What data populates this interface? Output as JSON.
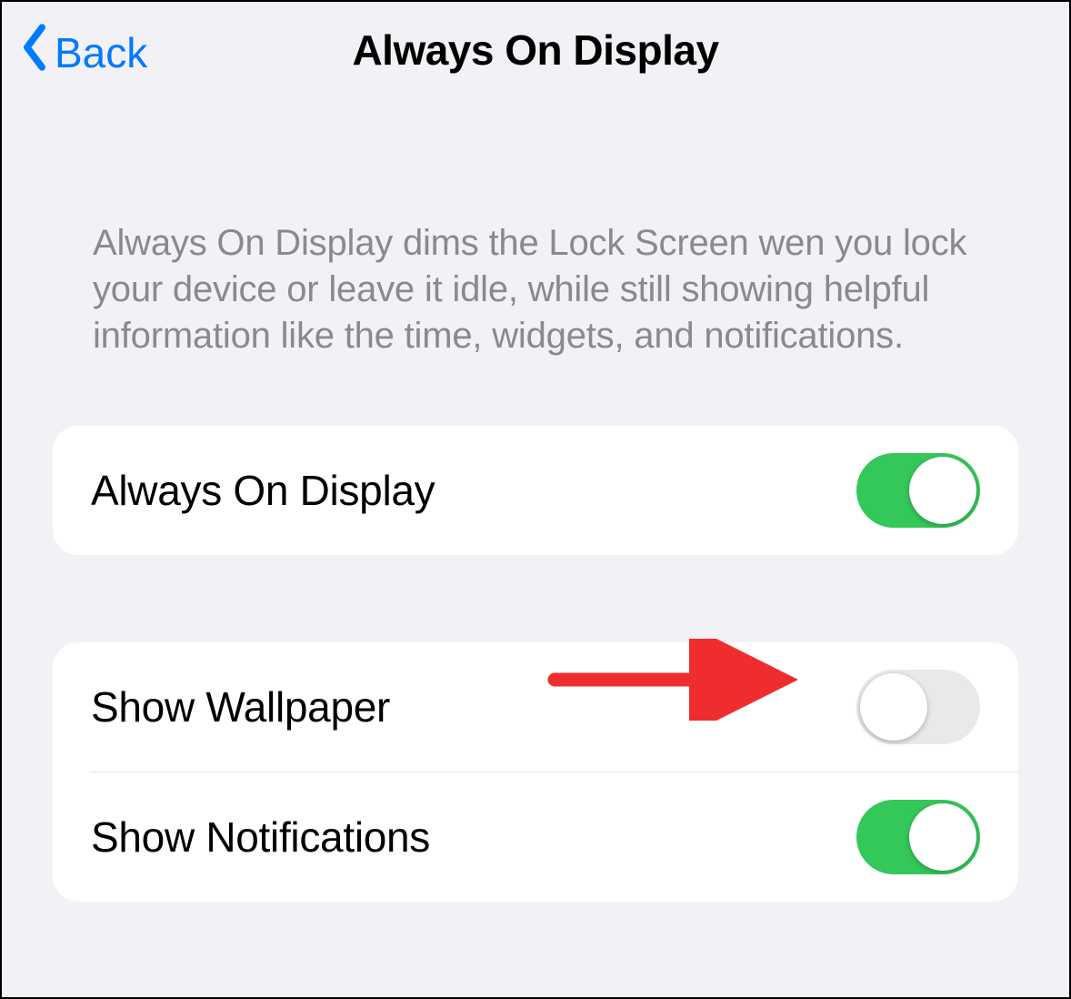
{
  "header": {
    "back_label": "Back",
    "title": "Always On Display"
  },
  "description": "Always On Display dims the Lock Screen wen you lock your device or leave it idle, while still showing helpful information like the time, widgets, and notifications.",
  "groups": {
    "primary": {
      "always_on_display": {
        "label": "Always On Display",
        "on": true
      }
    },
    "secondary": {
      "show_wallpaper": {
        "label": "Show Wallpaper",
        "on": false
      },
      "show_notifications": {
        "label": "Show Notifications",
        "on": true
      }
    }
  },
  "annotation": {
    "target": "show_wallpaper_toggle",
    "color": "#ef2d2f"
  }
}
